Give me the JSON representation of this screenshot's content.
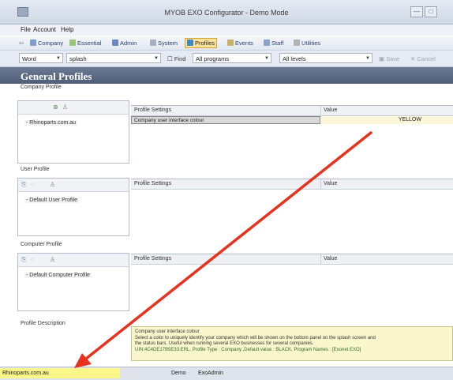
{
  "window": {
    "title": "MYOB EXO Configurator - Demo Mode",
    "controls": [
      "—",
      "□"
    ]
  },
  "menu": [
    "File",
    "Account",
    "Help"
  ],
  "toolbar": {
    "items": [
      "Company",
      "Essential",
      "Admin",
      "System",
      "Profiles",
      "Events",
      "Staff",
      "Utilities"
    ],
    "active": "Profiles"
  },
  "filters": {
    "search_scope": "Word",
    "search_value": "splash",
    "find_label": "Find",
    "program_filter": "All programs",
    "level_filter": "All levels",
    "save_label": "Save",
    "cancel_label": "Cancel"
  },
  "page_title": "General Profiles",
  "sections": [
    {
      "label": "Company Profile",
      "items": [
        "- Rhinoparts.com.au"
      ],
      "columns": [
        "Profile Settings",
        "Value"
      ],
      "rows": [
        {
          "setting": "Company user interface colour",
          "value": "YELLOW"
        }
      ]
    },
    {
      "label": "User Profile",
      "items": [
        "- Default User Profile"
      ],
      "columns": [
        "Profile Settings",
        "Value"
      ],
      "rows": []
    },
    {
      "label": "Computer Profile",
      "items": [
        "- Default Computer Profile"
      ],
      "columns": [
        "Profile Settings",
        "Value"
      ],
      "rows": []
    }
  ],
  "description": {
    "label": "Profile Description",
    "heading": "Company user interface colour",
    "line1": "Select a color to uniquely identify your company which will be shown on the bottom panel on the splash screen and",
    "line2": "the status bars. Useful when running several EXO businesses for several companies.",
    "line3": "UIN:4C4DE17B5E33:ERL, Profile Type : Company ,Default value : BLACK, Program Names : [Exonet EXO]"
  },
  "status": {
    "company": "Rhinoparts.com.au",
    "mode": "Demo",
    "user": "ExoAdmin"
  },
  "colors": {
    "annotation_arrow": "#e8321e",
    "status_highlight": "#fbf68a",
    "header": "#5a6a84"
  }
}
